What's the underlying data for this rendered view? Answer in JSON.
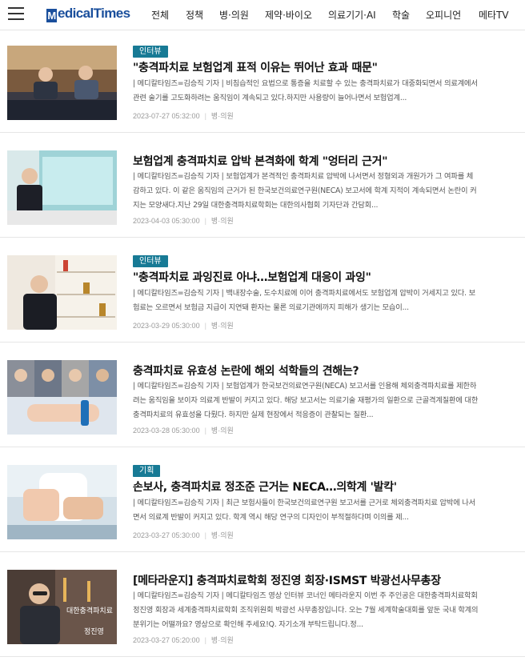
{
  "header": {
    "logo_mark": "M",
    "logo_text": "edicalTimes",
    "nav": [
      {
        "label": "전체"
      },
      {
        "label": "정책"
      },
      {
        "label": "병·의원"
      },
      {
        "label": "제약·바이오"
      },
      {
        "label": "의료기기·AI"
      },
      {
        "label": "학술"
      },
      {
        "label": "오피니언"
      },
      {
        "label": "메타TV"
      }
    ]
  },
  "articles": [
    {
      "badge": "인터뷰",
      "title": "\"충격파치료 보험업계 표적 이유는 뛰어난 효과 때문\"",
      "summary": "| 메디칼타임즈=김승직 기자 | 비침습적인 요법으로 통증을 치료할 수 있는 충격파치료가 대중화되면서 의료계에서 관련 술기를 고도화하려는 움직임이 계속되고 있다.하지만 사용량이 늘어나면서 보험업계...",
      "date": "2023-07-27 05:32:00",
      "category": "병·의원"
    },
    {
      "badge": "",
      "title": "보험업계 충격파치료 압박 본격화에 학계 \"엉터리 근거\"",
      "summary": "| 메디칼타임즈=김승직 기자 | 보험업계가 본격적인 충격파치료 압박에 나서면서 정형외과 개원가가 그 여파를 체감하고 있다. 이 같은 움직임의 근거가 된 한국보건의료연구원(NECA) 보고서에 학계 지적이 계속되면서 논란이 커지는 모양새다.지난 29일 대한충격파치료학회는 대한의사협회 기자단과 간담회...",
      "date": "2023-04-03 05:30:00",
      "category": "병·의원"
    },
    {
      "badge": "인터뷰",
      "title": "\"충격파치료 과잉진료 아냐…보험업계 대응이 과잉\"",
      "summary": "| 메디칼타임즈=김승직 기자 | 백내장수술, 도수치료에 이어 충격파치료에서도 보험업계 압박이 거세지고 있다. 보험료는 오르면서 보험금 지급이 지연돼 환자는 물론 의료기관에까지 피해가 생기는 모습이...",
      "date": "2023-03-29 05:30:00",
      "category": "병·의원"
    },
    {
      "badge": "",
      "title": "충격파치료 유효성 논란에 해외 석학들의 견해는?",
      "summary": "| 메디칼타임즈=김승직 기자 | 보험업계가 한국보건의료연구원(NECA) 보고서를 인용해 체외충격파치료를 제한하려는 움직임을 보이자 의료계 반발이 커지고 있다. 해당 보고서는 의료기술 재평가의 일환으로 근골격계질환에 대한 충격파치료의 유효성을 다뤘다. 하지만 실제 현장에서 적응증이 관찰되는 질환...",
      "date": "2023-03-28 05:30:00",
      "category": "병·의원"
    },
    {
      "badge": "기획",
      "title": "손보사, 충격파치료 정조준 근거는 NECA…의학계 '발칵'",
      "summary": "| 메디칼타임즈=김승직 기자 | 최근 보험사들이 한국보건의료연구원 보고서를 근거로 체외충격파치료 압박에 나서면서 의료계 반발이 커지고 있다. 학계 역시 해당 연구의 디자인이 부적절하다며 이의를 제...",
      "date": "2023-03-27 05:30:00",
      "category": "병·의원"
    },
    {
      "badge": "",
      "title": "[메타라운지] 충격파치료학회 정진영 회장·ISMST 박광선사무총장",
      "summary": "| 메디칼타임즈=김승직 기자 | 메디칼타임즈 영상 인터뷰 코너인 메타라운지 이번 주 주인공은 대한충격파치료학회 정진영 회장과 세계충격파치료학회 조직위원회 박광선 사무총장입니다. 오는 7월 세계학술대회를 앞둔 국내 학계의 분위기는 어떨까요? 영상으로 확인해 주세요!Q. 자기소개 부탁드립니다.정...",
      "date": "2023-03-27 05:20:00",
      "category": "병·의원",
      "thumb_caption_1": "대한충격파치료",
      "thumb_caption_2": "정진영"
    }
  ],
  "colors": {
    "brand": "#1a4f9c",
    "badge": "#177a95"
  }
}
